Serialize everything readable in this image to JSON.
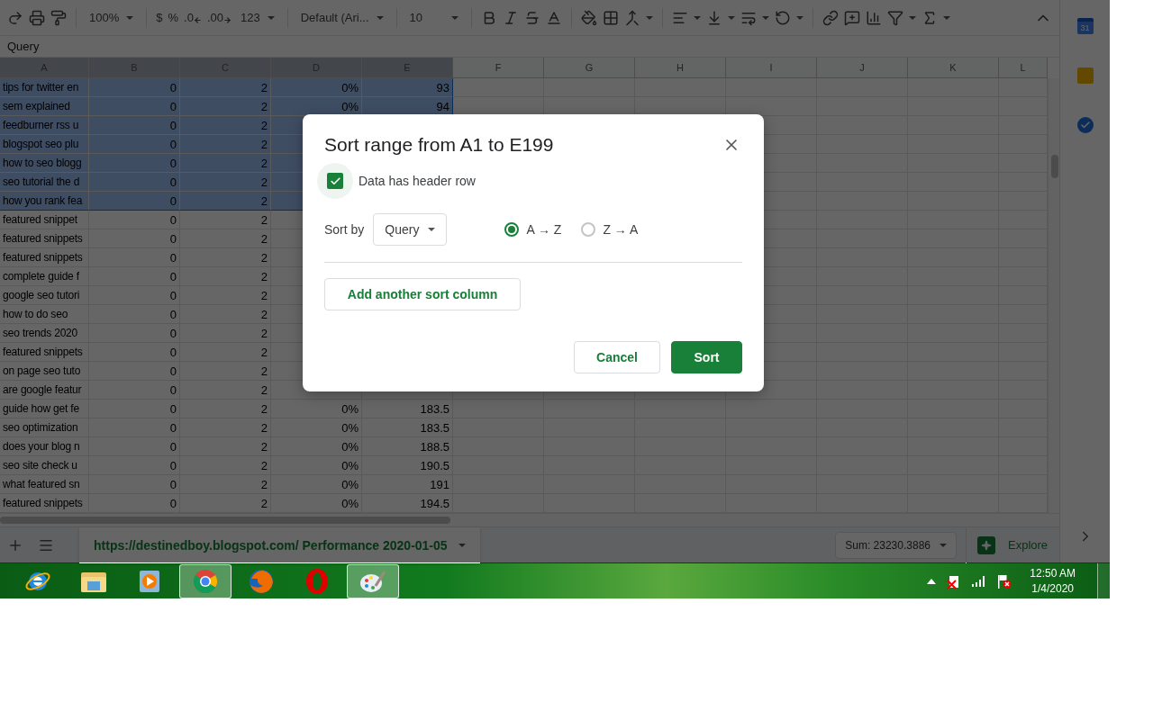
{
  "toolbar": {
    "zoom": "100%",
    "currency": "$",
    "percent": "%",
    "decrease_decimal": ".0",
    "increase_decimal": ".00",
    "more_formats": "123",
    "font": "Default (Ari...",
    "font_size": "10"
  },
  "formula_bar": {
    "value": "Query"
  },
  "columns": [
    {
      "label": "A",
      "selected": true
    },
    {
      "label": "B",
      "selected": true
    },
    {
      "label": "C",
      "selected": true
    },
    {
      "label": "D",
      "selected": true
    },
    {
      "label": "E",
      "selected": true
    },
    {
      "label": "F",
      "selected": false
    },
    {
      "label": "G",
      "selected": false
    },
    {
      "label": "H",
      "selected": false
    },
    {
      "label": "I",
      "selected": false
    },
    {
      "label": "J",
      "selected": false
    },
    {
      "label": "K",
      "selected": false
    },
    {
      "label": "L",
      "selected": false
    }
  ],
  "rows": [
    {
      "cells": [
        "tips for twitter en",
        "0",
        "2",
        "0%",
        "93"
      ],
      "selected": true
    },
    {
      "cells": [
        "sem explained",
        "0",
        "2",
        "0%",
        "94"
      ],
      "selected": true
    },
    {
      "cells": [
        "feedburner rss u",
        "0",
        "2"
      ],
      "selected": true
    },
    {
      "cells": [
        "blogspot seo plu",
        "0",
        "2"
      ],
      "selected": true
    },
    {
      "cells": [
        "how to seo blogg",
        "0",
        "2"
      ],
      "selected": true
    },
    {
      "cells": [
        "seo tutorial the d",
        "0",
        "2"
      ],
      "selected": true
    },
    {
      "cells": [
        "how you rank fea",
        "0",
        "2"
      ],
      "selected": true
    },
    {
      "cells": [
        "featured snippet",
        "0",
        "2"
      ],
      "selected": false
    },
    {
      "cells": [
        "featured snippets",
        "0",
        "2"
      ],
      "selected": false
    },
    {
      "cells": [
        "featured snippets",
        "0",
        "2"
      ],
      "selected": false
    },
    {
      "cells": [
        "complete guide f",
        "0",
        "2"
      ],
      "selected": false
    },
    {
      "cells": [
        "google seo tutori",
        "0",
        "2"
      ],
      "selected": false
    },
    {
      "cells": [
        "how to do seo",
        "0",
        "2"
      ],
      "selected": false
    },
    {
      "cells": [
        "seo trends 2020",
        "0",
        "2"
      ],
      "selected": false
    },
    {
      "cells": [
        "featured snippets",
        "0",
        "2"
      ],
      "selected": false
    },
    {
      "cells": [
        "on page seo tuto",
        "0",
        "2"
      ],
      "selected": false
    },
    {
      "cells": [
        "are google featur",
        "0",
        "2"
      ],
      "selected": false
    },
    {
      "cells": [
        "guide how get fe",
        "0",
        "2",
        "0%",
        "183.5"
      ],
      "selected": false
    },
    {
      "cells": [
        "seo optimization",
        "0",
        "2",
        "0%",
        "183.5"
      ],
      "selected": false
    },
    {
      "cells": [
        "does your blog n",
        "0",
        "2",
        "0%",
        "188.5"
      ],
      "selected": false
    },
    {
      "cells": [
        "seo site check u",
        "0",
        "2",
        "0%",
        "190.5"
      ],
      "selected": false
    },
    {
      "cells": [
        "what featured sn",
        "0",
        "2",
        "0%",
        "191"
      ],
      "selected": false
    },
    {
      "cells": [
        "featured snippets",
        "0",
        "2",
        "0%",
        "194.5"
      ],
      "selected": false
    }
  ],
  "sheet_bar": {
    "tab": {
      "label": "https://destinedboy.blogspot.com/ Performance 2020-01-05",
      "selected": true
    },
    "sum": "Sum: 23230.3886",
    "explore": "Explore"
  },
  "side_panel": {
    "calendar_day": "31"
  },
  "dialog": {
    "title": "Sort range from A1 to E199",
    "header_row": {
      "label": "Data has header row",
      "checked": true
    },
    "sort_by_label": "Sort by",
    "sort_column": "Query",
    "orders": [
      {
        "label": "A → Z",
        "selected": true
      },
      {
        "label": "Z → A",
        "selected": false
      }
    ],
    "add_button": "Add another sort column",
    "cancel": "Cancel",
    "confirm": "Sort"
  },
  "taskbar": {
    "apps": [
      {
        "highlighted": false
      },
      {
        "highlighted": false
      },
      {
        "highlighted": false
      },
      {
        "highlighted": true
      },
      {
        "highlighted": false
      },
      {
        "highlighted": false
      },
      {
        "highlighted": true
      }
    ],
    "time": "12:50 AM",
    "date": "1/4/2020"
  }
}
